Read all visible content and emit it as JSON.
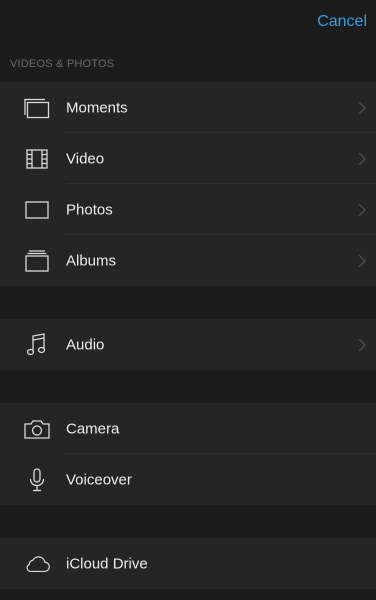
{
  "header": {
    "cancel_label": "Cancel"
  },
  "section": {
    "title": "VIDEOS & PHOTOS"
  },
  "media_items": [
    {
      "label": "Moments",
      "icon": "moments-icon"
    },
    {
      "label": "Video",
      "icon": "film-icon"
    },
    {
      "label": "Photos",
      "icon": "photos-icon"
    },
    {
      "label": "Albums",
      "icon": "albums-icon"
    }
  ],
  "audio_item": {
    "label": "Audio",
    "icon": "music-note-icon"
  },
  "capture_items": [
    {
      "label": "Camera",
      "icon": "camera-icon"
    },
    {
      "label": "Voiceover",
      "icon": "microphone-icon"
    }
  ],
  "cloud_item": {
    "label": "iCloud Drive",
    "icon": "cloud-icon"
  },
  "colors": {
    "accent": "#3a9be3",
    "background": "#1c1c1c",
    "row": "#252525"
  }
}
